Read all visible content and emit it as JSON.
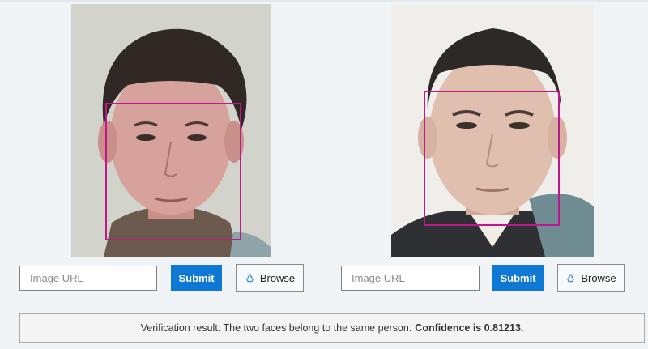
{
  "left_panel": {
    "url_placeholder": "Image URL",
    "submit_label": "Submit",
    "browse_label": "Browse",
    "browse_icon": "recycle-icon"
  },
  "right_panel": {
    "url_placeholder": "Image URL",
    "submit_label": "Submit",
    "browse_label": "Browse",
    "browse_icon": "recycle-icon"
  },
  "result": {
    "text": "Verification result: The two faces belong to the same person.",
    "confidence": "Confidence is 0.81213."
  },
  "colors": {
    "background": "#f1f4f7",
    "face_box": "#c0178f",
    "submit_bg": "#0f78d4"
  }
}
